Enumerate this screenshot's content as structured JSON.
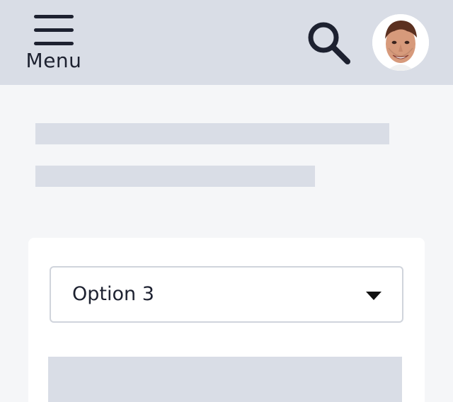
{
  "header": {
    "menu_label": "Menu",
    "menu_icon": "hamburger-icon",
    "search_icon": "search-icon",
    "avatar_icon": "avatar"
  },
  "form": {
    "select_value": "Option 3"
  },
  "colors": {
    "header_bg": "#d9dde6",
    "page_bg": "#f5f6f8",
    "text": "#1d2130",
    "skeleton": "#d9dde6"
  }
}
